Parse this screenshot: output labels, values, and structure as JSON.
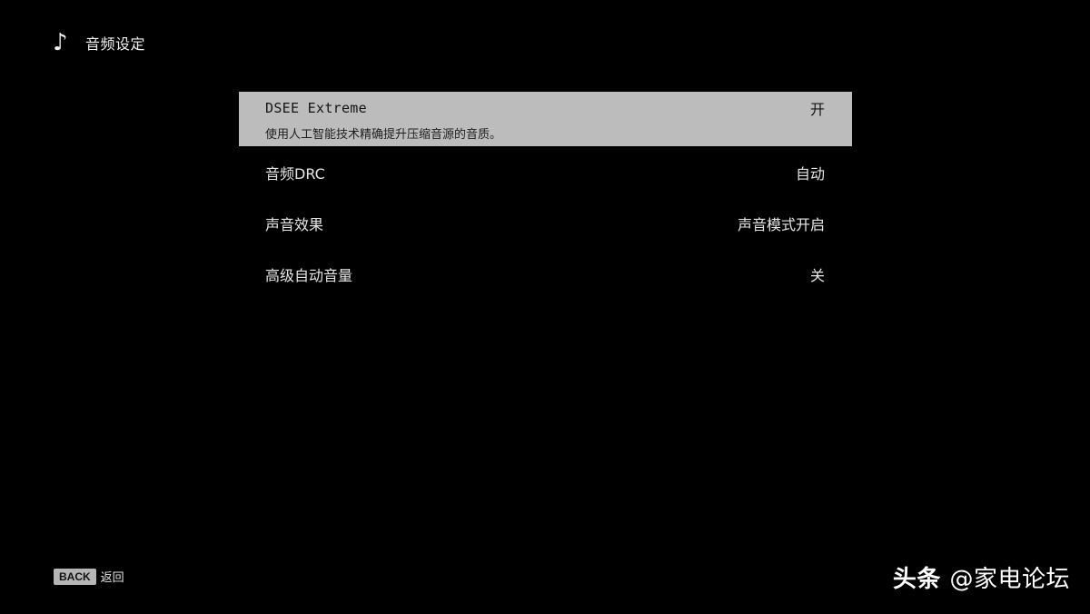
{
  "header": {
    "icon": "music-note-icon",
    "title": "音频设定"
  },
  "menu": {
    "items": [
      {
        "label": "DSEE Extreme",
        "value": "开",
        "description": "使用人工智能技术精确提升压缩音源的音质。",
        "selected": true
      },
      {
        "label": "音频DRC",
        "value": "自动"
      },
      {
        "label": "声音效果",
        "value": "声音模式开启"
      },
      {
        "label": "高级自动音量",
        "value": "关"
      }
    ]
  },
  "footer": {
    "back_key": "BACK",
    "back_label": "返回"
  },
  "watermark": {
    "brand": "头条",
    "handle": "@家电论坛"
  },
  "colors": {
    "background": "#000000",
    "selected_row": "#bcbcbc",
    "text": "#e6e6e6"
  }
}
